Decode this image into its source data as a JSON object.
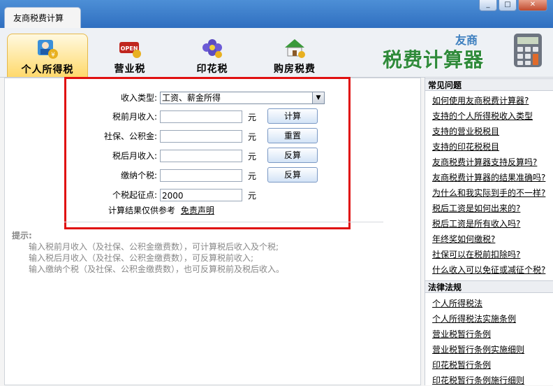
{
  "window": {
    "tab_title": "友商税费计算",
    "buttons": {
      "minimize": "_",
      "maximize": "□",
      "close": "✕"
    }
  },
  "nav": {
    "tabs": [
      {
        "label": "个人所得税",
        "icon": "person-tax-icon",
        "active": true
      },
      {
        "label": "营业税",
        "icon": "open-sign-icon",
        "active": false
      },
      {
        "label": "印花税",
        "icon": "flower-stamp-icon",
        "active": false
      },
      {
        "label": "购房税费",
        "icon": "house-icon",
        "active": false
      }
    ]
  },
  "brand": {
    "small": "友商",
    "big": "税费计算器",
    "icon": "calculator-icon"
  },
  "form": {
    "income_type_label": "收入类型:",
    "income_type_value": "工资、薪金所得",
    "rows": [
      {
        "label": "税前月收入:",
        "value": "",
        "unit": "元",
        "button": "计算"
      },
      {
        "label": "社保、公积金:",
        "value": "",
        "unit": "元",
        "button": "重置"
      },
      {
        "label": "税后月收入:",
        "value": "",
        "unit": "元",
        "button": "反算"
      },
      {
        "label": "缴纳个税:",
        "value": "",
        "unit": "元",
        "button": "反算"
      },
      {
        "label": "个税起征点:",
        "value": "2000",
        "unit": "元",
        "button": ""
      }
    ],
    "disclaimer": "计算结果仅供参考",
    "disclaimer_link": "免责声明"
  },
  "hints": {
    "title": "提示:",
    "lines": [
      "输入税前月收入（及社保、公积金缴费数），可计算税后收入及个税;",
      "输入税后月收入（及社保、公积金缴费数），可反算税前收入;",
      "输入缴纳个税（及社保、公积金缴费数），也可反算税前及税后收入。"
    ]
  },
  "sidebar": {
    "faq_title": "常见问题",
    "faq": [
      "如何使用友商税费计算器?",
      "支持的个人所得税收入类型",
      "支持的营业税税目",
      "支持的印花税税目",
      "友商税费计算器支持反算吗?",
      "友商税费计算器的结果准确吗?",
      "为什么和我实际到手的不一样?",
      "税后工资是如何出来的?",
      "税后工资是所有收入吗?",
      "年终奖如何缴税?",
      "社保可以在税前扣除吗?",
      "什么收入可以免征或减征个税?"
    ],
    "law_title": "法律法规",
    "laws": [
      "个人所得税法",
      "个人所得税法实施条例",
      "营业税暂行条例",
      "营业税暂行条例实施细则",
      "印花税暂行条例",
      "印花税暂行条例施行细则"
    ]
  },
  "colors": {
    "title_bar": "#3a7cc8",
    "active_tab": "#ffd96b",
    "red_frame": "#e01010",
    "brand_green": "#2f8a3a"
  }
}
